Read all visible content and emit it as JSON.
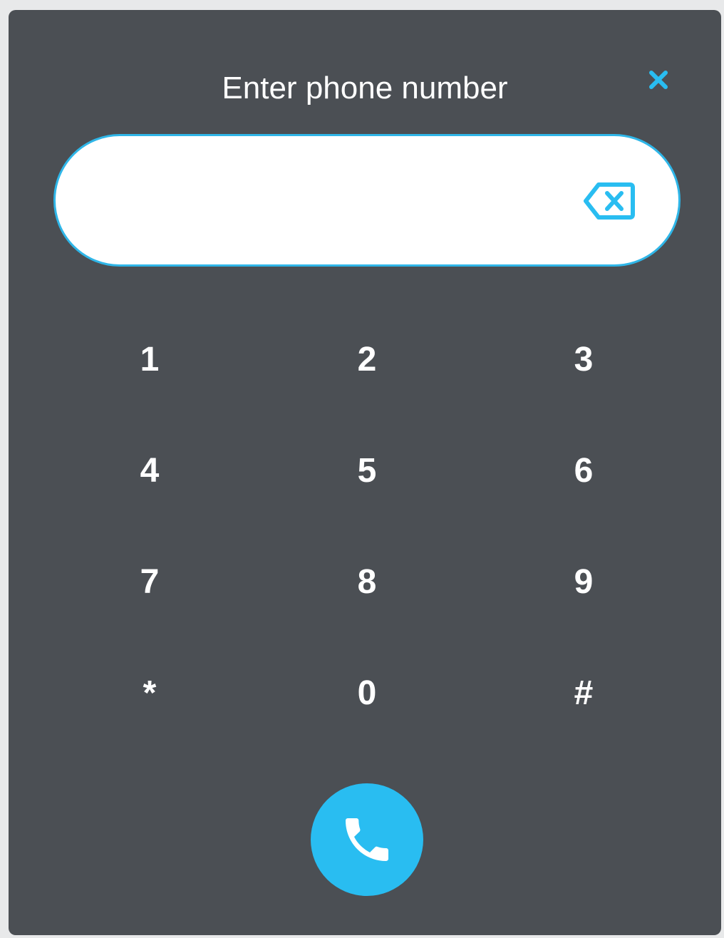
{
  "dialog": {
    "title": "Enter phone number",
    "close_icon": "close-icon",
    "accent_color": "#29bdf1",
    "background_color": "#4b4f54"
  },
  "phone_field": {
    "value": "",
    "placeholder": "",
    "clear_icon": "backspace-icon"
  },
  "keypad": {
    "keys": [
      {
        "label": "1"
      },
      {
        "label": "2"
      },
      {
        "label": "3"
      },
      {
        "label": "4"
      },
      {
        "label": "5"
      },
      {
        "label": "6"
      },
      {
        "label": "7"
      },
      {
        "label": "8"
      },
      {
        "label": "9"
      },
      {
        "label": "*"
      },
      {
        "label": "0"
      },
      {
        "label": "#"
      }
    ]
  },
  "call": {
    "icon": "phone-icon"
  }
}
